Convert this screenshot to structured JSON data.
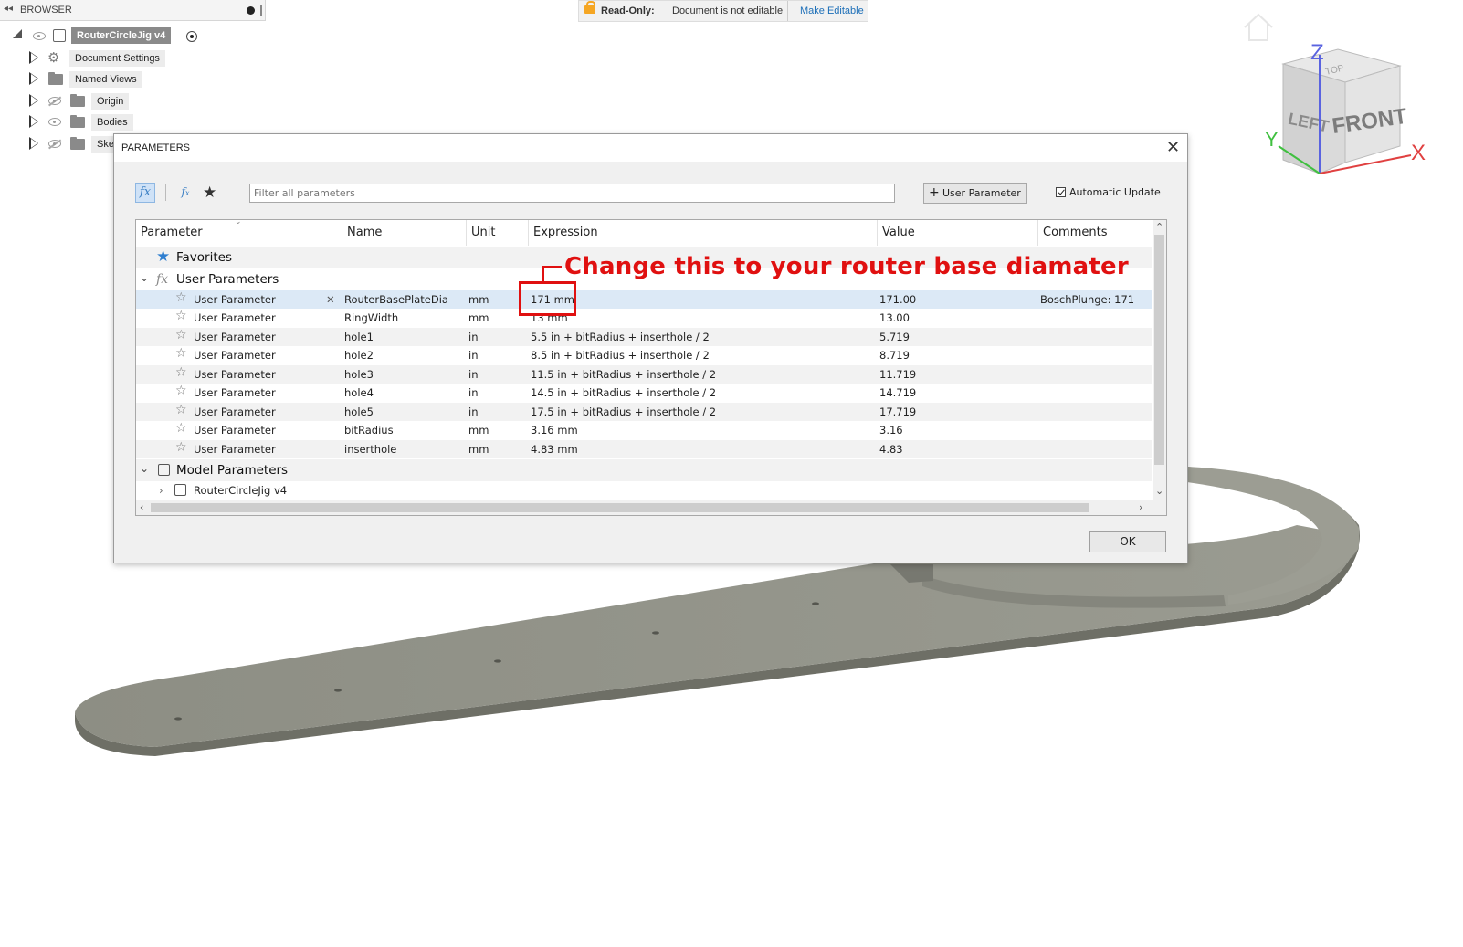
{
  "browser": {
    "header_title": "BROWSER",
    "root": {
      "label": "RouterCircleJig v4"
    },
    "items": [
      {
        "label": "Document Settings",
        "icon": "gear-icon"
      },
      {
        "label": "Named Views",
        "icon": "folder-icon"
      },
      {
        "label": "Origin",
        "icon": "folder-icon"
      },
      {
        "label": "Bodies",
        "icon": "folder-icon"
      },
      {
        "label": "Ske",
        "icon": "folder-icon"
      }
    ]
  },
  "readonly_bar": {
    "label": "Read-Only:",
    "message": "Document is not editable",
    "action": "Make Editable",
    "accent": "#f5a623"
  },
  "viewcube": {
    "axis_z": "Z",
    "axis_y": "Y",
    "axis_x": "X",
    "face_front": "FRONT",
    "face_left": "LEFT",
    "face_top": "TOP"
  },
  "dialog": {
    "title": "PARAMETERS",
    "filter_placeholder": "Filter all parameters",
    "add_button": "User Parameter",
    "auto_update_label": "Automatic Update",
    "auto_update_checked": true,
    "ok_label": "OK",
    "columns": [
      "Parameter",
      "Name",
      "Unit",
      "Expression",
      "Value",
      "Comments"
    ],
    "groups": {
      "favorites": "Favorites",
      "user": "User Parameters",
      "model": "Model Parameters"
    },
    "rows": [
      {
        "param": "User Parameter",
        "name": "RouterBasePlateDia",
        "unit": "mm",
        "expr": "171 mm",
        "value": "171.00",
        "comment": "BoschPlunge: 171"
      },
      {
        "param": "User Parameter",
        "name": "RingWidth",
        "unit": "mm",
        "expr": "13 mm",
        "value": "13.00",
        "comment": ""
      },
      {
        "param": "User Parameter",
        "name": "hole1",
        "unit": "in",
        "expr": "5.5 in + bitRadius + inserthole / 2",
        "value": "5.719",
        "comment": ""
      },
      {
        "param": "User Parameter",
        "name": "hole2",
        "unit": "in",
        "expr": "8.5 in + bitRadius + inserthole / 2",
        "value": "8.719",
        "comment": ""
      },
      {
        "param": "User Parameter",
        "name": "hole3",
        "unit": "in",
        "expr": "11.5 in + bitRadius + inserthole / 2",
        "value": "11.719",
        "comment": ""
      },
      {
        "param": "User Parameter",
        "name": "hole4",
        "unit": "in",
        "expr": "14.5 in + bitRadius + inserthole / 2",
        "value": "14.719",
        "comment": ""
      },
      {
        "param": "User Parameter",
        "name": "hole5",
        "unit": "in",
        "expr": "17.5 in + bitRadius + inserthole / 2",
        "value": "17.719",
        "comment": ""
      },
      {
        "param": "User Parameter",
        "name": "bitRadius",
        "unit": "mm",
        "expr": "3.16 mm",
        "value": "3.16",
        "comment": ""
      },
      {
        "param": "User Parameter",
        "name": "inserthole",
        "unit": "mm",
        "expr": "4.83 mm",
        "value": "4.83",
        "comment": ""
      }
    ],
    "model_child": "RouterCircleJig v4"
  },
  "annotation": {
    "text": "Change this to your router base diamater",
    "color": "#e01010"
  }
}
